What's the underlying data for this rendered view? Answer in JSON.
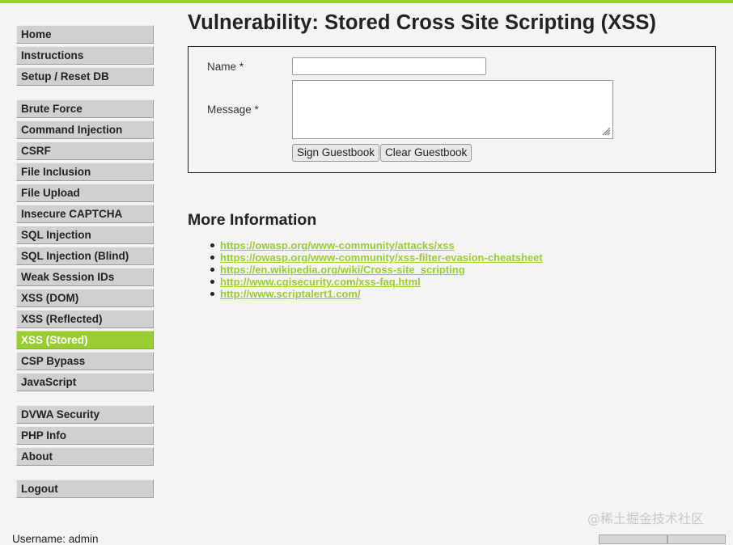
{
  "page_title": "Vulnerability: Stored Cross Site Scripting (XSS)",
  "colors": {
    "accent": "#9acd32",
    "menu_bg": "#d0d0d0",
    "page_bg": "#f4f4f4"
  },
  "sidebar": {
    "groups": [
      [
        {
          "label": "Home"
        },
        {
          "label": "Instructions"
        },
        {
          "label": "Setup / Reset DB"
        }
      ],
      [
        {
          "label": "Brute Force"
        },
        {
          "label": "Command Injection"
        },
        {
          "label": "CSRF"
        },
        {
          "label": "File Inclusion"
        },
        {
          "label": "File Upload"
        },
        {
          "label": "Insecure CAPTCHA"
        },
        {
          "label": "SQL Injection"
        },
        {
          "label": "SQL Injection (Blind)"
        },
        {
          "label": "Weak Session IDs"
        },
        {
          "label": "XSS (DOM)"
        },
        {
          "label": "XSS (Reflected)"
        },
        {
          "label": "XSS (Stored)",
          "selected": true
        },
        {
          "label": "CSP Bypass"
        },
        {
          "label": "JavaScript"
        }
      ],
      [
        {
          "label": "DVWA Security"
        },
        {
          "label": "PHP Info"
        },
        {
          "label": "About"
        }
      ],
      [
        {
          "label": "Logout"
        }
      ]
    ]
  },
  "form": {
    "name_label": "Name *",
    "name_value": "",
    "message_label": "Message *",
    "message_value": "",
    "sign_button": "Sign Guestbook",
    "clear_button": "Clear Guestbook"
  },
  "more_info": {
    "heading": "More Information",
    "links": [
      "https://owasp.org/www-community/attacks/xss",
      "https://owasp.org/www-community/xss-filter-evasion-cheatsheet",
      "https://en.wikipedia.org/wiki/Cross-site_scripting",
      "http://www.cgisecurity.com/xss-faq.html",
      "http://www.scriptalert1.com/"
    ]
  },
  "footer": {
    "username_line": "Username: admin"
  },
  "watermark": "@稀土掘金技术社区"
}
